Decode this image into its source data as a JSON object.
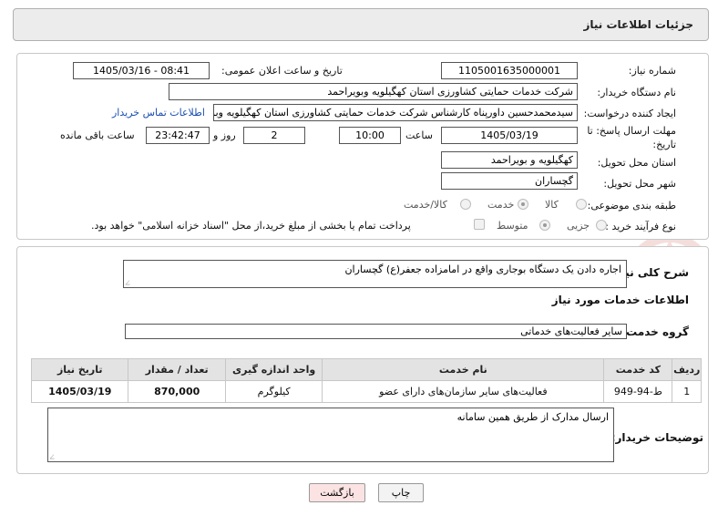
{
  "header": {
    "title": "جزئیات اطلاعات نیاز"
  },
  "form": {
    "need_number_label": "شماره نیاز:",
    "need_number": "1105001635000001",
    "announce_label": "تاریخ و ساعت اعلان عمومی:",
    "announce_value": "1405/03/16 - 08:41",
    "buyer_org_label": "نام دستگاه خریدار:",
    "buyer_org": "شرکت خدمات حمایتی کشاورزی استان کهگیلویه وبویراحمد",
    "creator_label": "ایجاد کننده درخواست:",
    "creator": "سیدمحمدحسین داورپناه کارشناس شرکت خدمات حمایتی کشاورزی استان کهگیلویه وبویراحمد",
    "contact_link": "اطلاعات تماس خریدار",
    "deadline_label_1": "مهلت ارسال پاسخ: تا",
    "deadline_label_2": "تاریخ:",
    "deadline_date": "1405/03/19",
    "time_label": "ساعت",
    "deadline_time": "10:00",
    "days_value": "2",
    "days_label": "روز و",
    "remaining_time": "23:42:47",
    "remaining_label": "ساعت باقی مانده",
    "province_label": "استان محل تحویل:",
    "province": "کهگیلویه و بویراحمد",
    "city_label": "شهر محل تحویل:",
    "city": "گچساران",
    "category_label": "طبقه بندی موضوعی:",
    "category_options": [
      "کالا",
      "خدمت",
      "کالا/خدمت"
    ],
    "category_selected": "خدمت",
    "process_label": "نوع فرآیند خرید :",
    "process_options": [
      "جزیی",
      "متوسط"
    ],
    "process_selected": "جزیی",
    "payment_note": "پرداخت تمام یا بخشی از مبلغ خرید،از محل \"اسناد خزانه اسلامی\" خواهد بود."
  },
  "summary": {
    "label": "شرح کلی نیاز:",
    "text": "اجاره دادن یک دستگاه بوجاری واقع در امامزاده جعفر(ع) گچساران"
  },
  "services": {
    "title": "اطلاعات خدمات مورد نیاز",
    "group_label": "گروه خدمت:",
    "group_value": "سایر فعالیت‌های خدماتی",
    "columns": [
      "ردیف",
      "کد خدمت",
      "نام خدمت",
      "واحد اندازه گیری",
      "تعداد / مقدار",
      "تاریخ نیاز"
    ],
    "rows": [
      [
        "1",
        "ط-94-949",
        "فعالیت‌های سایر سازمان‌های دارای عضو",
        "کیلوگرم",
        "870,000",
        "1405/03/19"
      ]
    ]
  },
  "buyer_notes": {
    "label": "توضیحات خریدار:",
    "text": "ارسال مدارک از طریق همین سامانه"
  },
  "buttons": {
    "print": "چاپ",
    "back": "بازگشت"
  },
  "watermark_text": "AriaTender.neT",
  "colors": {
    "link": "#1a4fb0",
    "back_button_bg": "#fbe3e3",
    "header_bg": "#ececec"
  }
}
